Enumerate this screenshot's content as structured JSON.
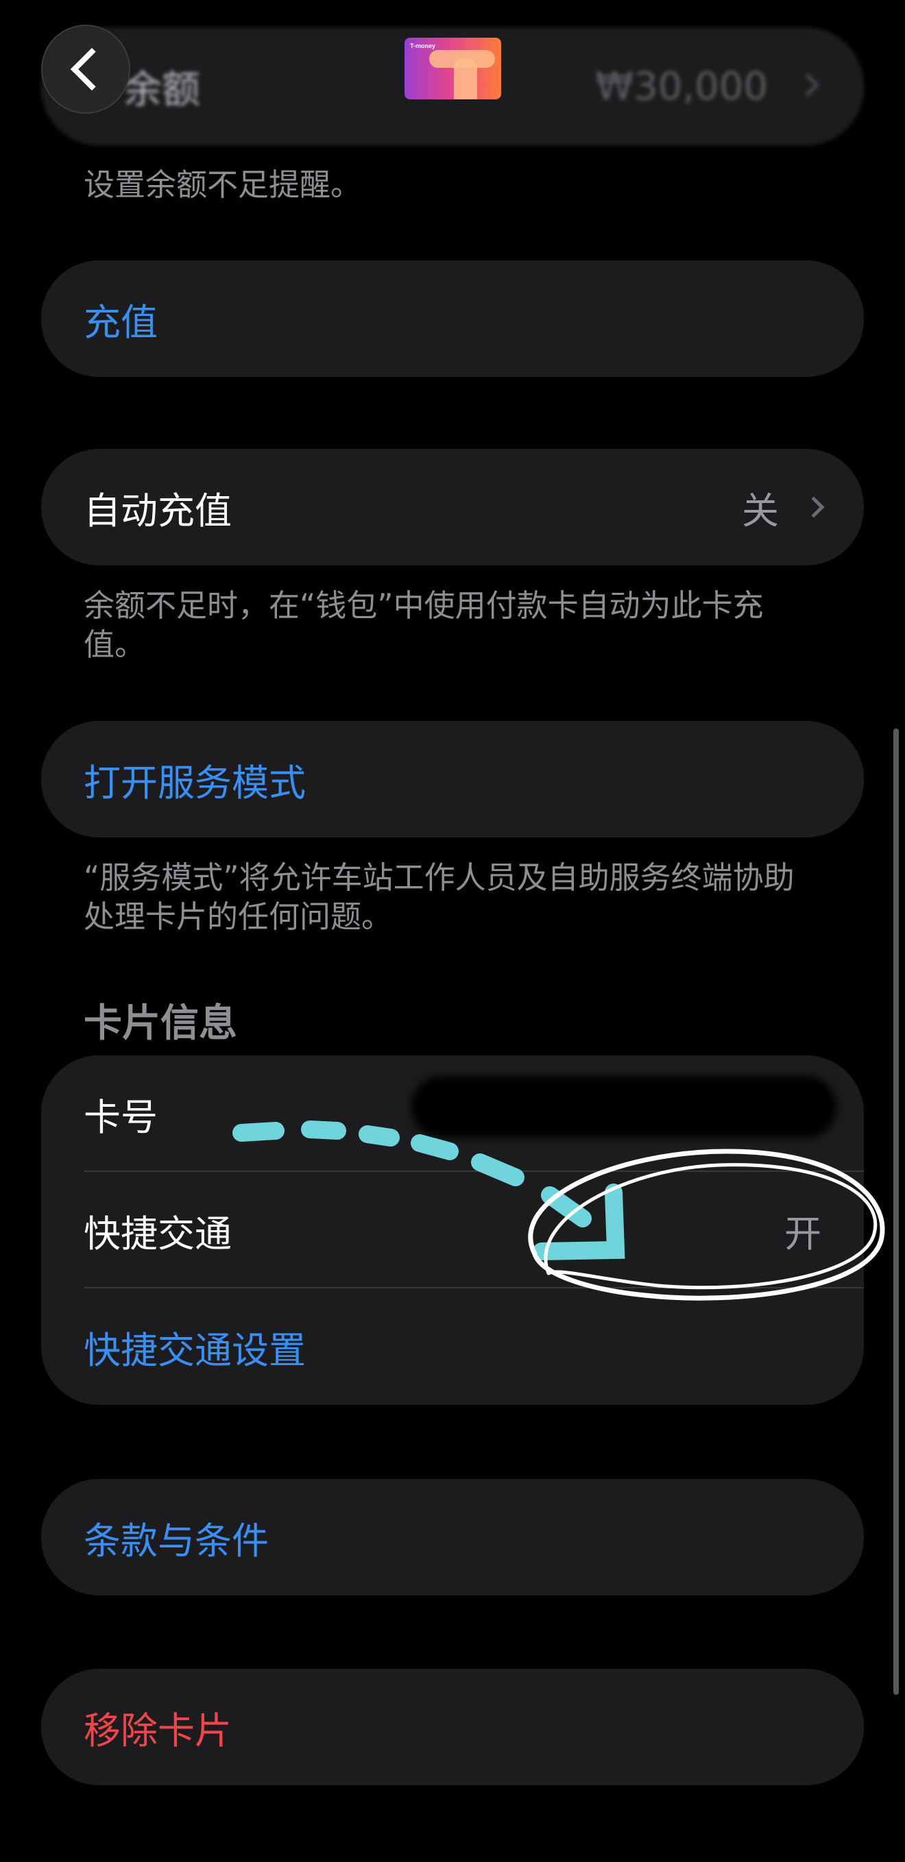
{
  "header": {
    "balance_label": "余额",
    "balance_value": "₩30,000",
    "card_brand": "T-money"
  },
  "balance_footer": "设置余额不足提醒。",
  "top_up": {
    "label": "充值"
  },
  "auto_top_up": {
    "label": "自动充值",
    "value": "关",
    "footer": "余额不足时，在“钱包”中使用付款卡自动为此卡充值。"
  },
  "service_mode": {
    "label": "打开服务模式",
    "footer": "“服务模式”将允许车站工作人员及自助服务终端协助处理卡片的任何问题。"
  },
  "card_info": {
    "header": "卡片信息",
    "card_number_label": "卡号",
    "express_transit_label": "快捷交通",
    "express_transit_value": "开",
    "express_transit_settings": "快捷交通设置"
  },
  "terms": {
    "label": "条款与条件"
  },
  "remove_card": {
    "label": "移除卡片"
  },
  "colors": {
    "accent_blue": "#3a8ff5",
    "destructive_red": "#f0464b",
    "annotation_cyan": "#6fd4dc",
    "annotation_white": "#ffffff"
  }
}
